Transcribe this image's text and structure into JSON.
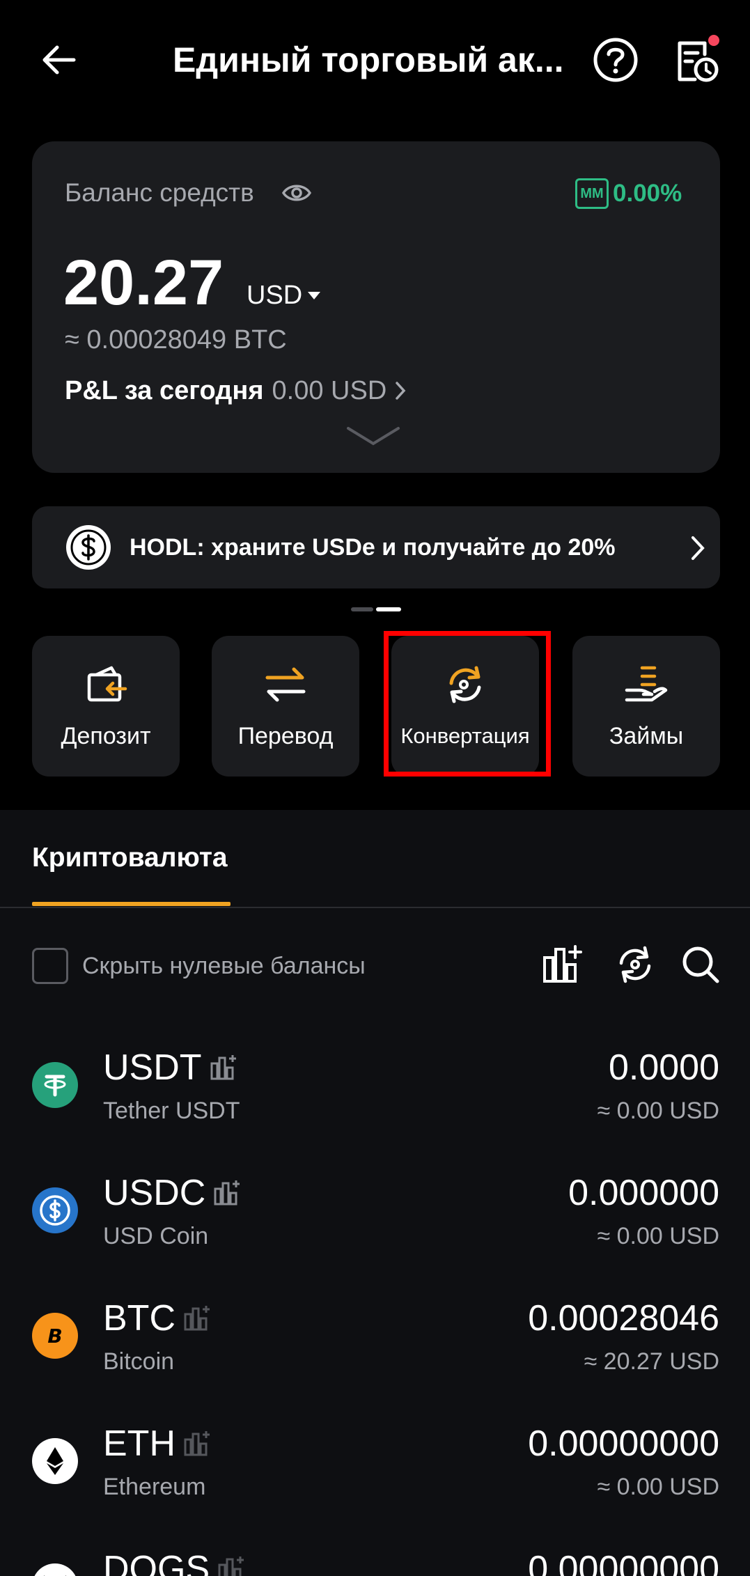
{
  "header": {
    "title": "Единый торговый ак...",
    "has_notification_dot": true
  },
  "balance": {
    "label": "Баланс средств",
    "mm_badge": "MM",
    "mm_value": "0.00%",
    "amount": "20.27",
    "currency": "USD",
    "btc_equivalent": "≈ 0.00028049 BTC",
    "pnl_label": "P&L за сегодня",
    "pnl_value": "0.00 USD"
  },
  "promo": {
    "text": "HODL: храните USDe и получайте до 20%"
  },
  "actions": [
    {
      "label": "Депозит",
      "icon": "deposit-icon"
    },
    {
      "label": "Перевод",
      "icon": "transfer-icon"
    },
    {
      "label": "Конвертация",
      "icon": "convert-icon",
      "highlighted": true
    },
    {
      "label": "Займы",
      "icon": "loans-icon"
    }
  ],
  "tabs": {
    "crypto": "Криптовалюта"
  },
  "filters": {
    "hide_zero_label": "Скрыть нулевые балансы",
    "hide_zero_checked": false
  },
  "assets": [
    {
      "symbol": "USDT",
      "name": "Tether USDT",
      "amount": "0.0000",
      "usd": "≈ 0.00 USD",
      "color": "#26a17b"
    },
    {
      "symbol": "USDC",
      "name": "USD Coin",
      "amount": "0.000000",
      "usd": "≈ 0.00 USD",
      "color": "#2775ca"
    },
    {
      "symbol": "BTC",
      "name": "Bitcoin",
      "amount": "0.00028046",
      "usd": "≈ 20.27 USD",
      "color": "#f7931a"
    },
    {
      "symbol": "ETH",
      "name": "Ethereum",
      "amount": "0.00000000",
      "usd": "≈ 0.00 USD",
      "color": "#ffffff"
    },
    {
      "symbol": "DOGS",
      "name": "",
      "amount": "0.00000000",
      "usd": "",
      "color": "#ffffff"
    }
  ],
  "colors": {
    "accent": "#f0a322",
    "positive": "#2ebd85",
    "highlight_border": "#ff0000",
    "card_bg": "#1b1c1f"
  }
}
